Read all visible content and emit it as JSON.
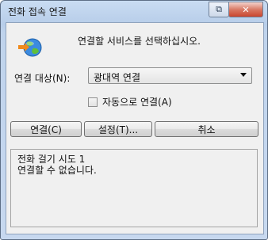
{
  "window": {
    "title": "전화 접속 연결",
    "restore_glyph": "⧉",
    "close_glyph": "✕"
  },
  "dialog": {
    "message": "연결할 서비스를 선택하십시오.",
    "target_label": "연결 대상(N):",
    "target_value": "광대역 연결",
    "auto_connect_label": "자동으로 연결(A)",
    "auto_connect_checked": false
  },
  "buttons": {
    "connect": "연결(C)",
    "settings": "설정(T)...",
    "cancel": "취소"
  },
  "status": {
    "line1": "전화 걸기 시도 1",
    "line2": "연결할 수 없습니다."
  }
}
